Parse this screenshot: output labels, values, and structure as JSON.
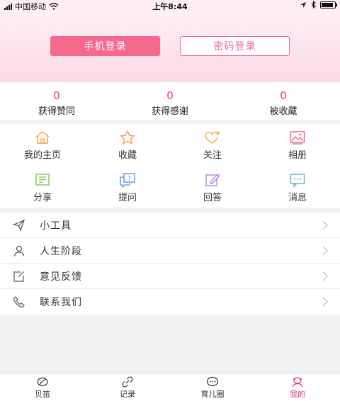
{
  "status_bar": {
    "carrier": "中国移动",
    "time": "上午8:44"
  },
  "header": {
    "phone_login": "手机登录",
    "password_login": "密码登录"
  },
  "stats": [
    {
      "value": "0",
      "label": "获得赞同"
    },
    {
      "value": "0",
      "label": "获得感谢"
    },
    {
      "value": "0",
      "label": "被收藏"
    }
  ],
  "grid": [
    {
      "label": "我的主页",
      "icon": "home-icon"
    },
    {
      "label": "收藏",
      "icon": "star-icon"
    },
    {
      "label": "关注",
      "icon": "heart-plus-icon"
    },
    {
      "label": "相册",
      "icon": "album-icon"
    },
    {
      "label": "分享",
      "icon": "share-icon"
    },
    {
      "label": "提问",
      "icon": "question-icon"
    },
    {
      "label": "回答",
      "icon": "pencil-icon"
    },
    {
      "label": "消息",
      "icon": "message-icon"
    }
  ],
  "menu": [
    {
      "label": "小工具",
      "icon": "paper-plane-icon"
    },
    {
      "label": "人生阶段",
      "icon": "person-icon"
    },
    {
      "label": "意见反馈",
      "icon": "feedback-icon"
    },
    {
      "label": "联系我们",
      "icon": "phone-icon"
    }
  ],
  "tabs": [
    {
      "label": "贝苗",
      "icon": "sprout-icon"
    },
    {
      "label": "记录",
      "icon": "link-icon"
    },
    {
      "label": "育儿圈",
      "icon": "chat-icon"
    },
    {
      "label": "我的",
      "icon": "profile-icon",
      "active": true
    }
  ],
  "colors": {
    "accent": "#f5698f",
    "stat_number": "#e8336b",
    "active_tab": "#e8336b"
  }
}
